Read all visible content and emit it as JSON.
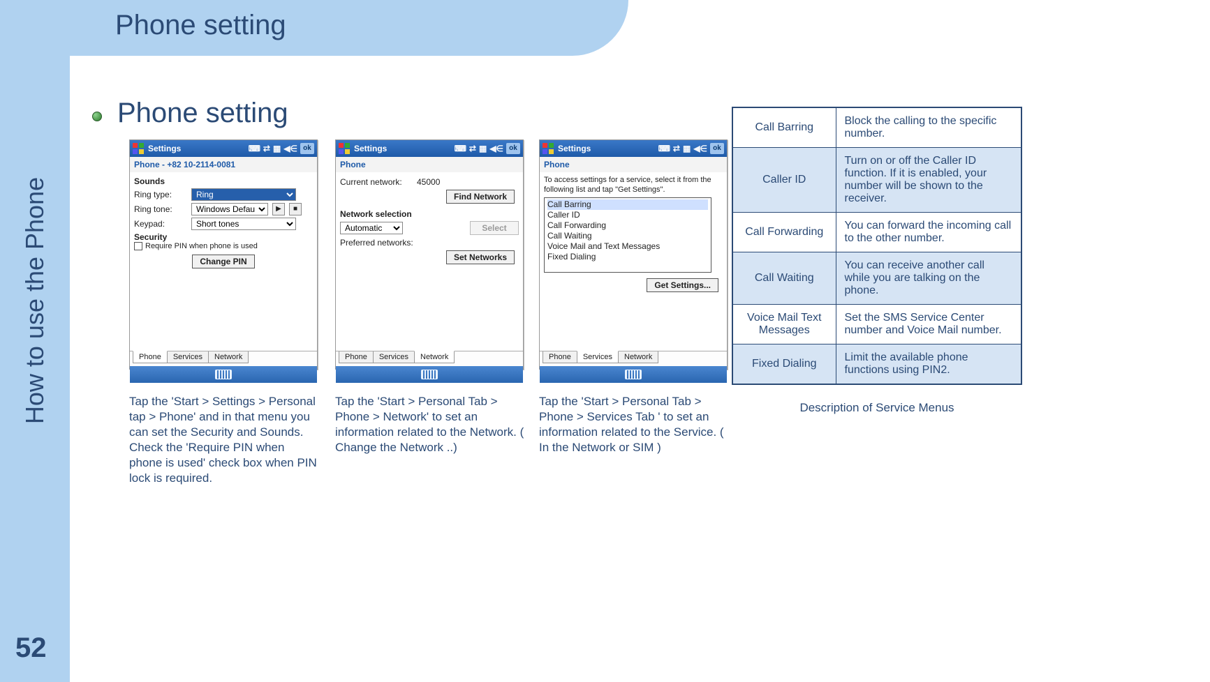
{
  "page": {
    "title": "Phone setting",
    "section_heading": "Phone setting",
    "side_label": "How to use the Phone",
    "number": "52"
  },
  "pda_common": {
    "window_title": "Settings",
    "ok": "ok",
    "tabs": {
      "phone": "Phone",
      "services": "Services",
      "network": "Network"
    }
  },
  "pda1": {
    "subheader": "Phone - +82 10-2114-0081",
    "sounds_label": "Sounds",
    "ring_type_label": "Ring type:",
    "ring_type_value": "Ring",
    "ring_tone_label": "Ring tone:",
    "ring_tone_value": "Windows Default",
    "keypad_label": "Keypad:",
    "keypad_value": "Short tones",
    "security_label": "Security",
    "require_pin_label": "Require PIN when phone is used",
    "change_pin": "Change PIN"
  },
  "pda2": {
    "subheader": "Phone",
    "current_network_label": "Current network:",
    "current_network_value": "45000",
    "find_network": "Find Network",
    "netsel_label": "Network selection",
    "netsel_value": "Automatic",
    "select_btn": "Select",
    "pref_label": "Preferred networks:",
    "set_networks": "Set Networks"
  },
  "pda3": {
    "subheader": "Phone",
    "intro": "To access settings for a service, select it from the following list and tap \"Get Settings\".",
    "items": [
      "Call Barring",
      "Caller ID",
      "Call Forwarding",
      "Call Waiting",
      "Voice Mail and Text Messages",
      "Fixed Dialing"
    ],
    "get_settings": "Get Settings..."
  },
  "captions": {
    "c1": "Tap the 'Start > Settings > Personal tap > Phone' and in that menu you can set the Security and Sounds. Check the 'Require PIN when phone is used' check box when PIN lock is required.",
    "c2": "Tap the 'Start > Personal Tab > Phone > Network' to set an information related to the Network. ( Change the Network ..)",
    "c3": "Tap the 'Start > Personal Tab > Phone > Services Tab ' to set an information related to the Service. ( In the Network or SIM )"
  },
  "service_table": {
    "caption": "Description of Service Menus",
    "rows": [
      {
        "name": "Call Barring",
        "desc": "Block the calling to the specific number."
      },
      {
        "name": "Caller ID",
        "desc": "Turn on or off the Caller ID function. If it is enabled, your number will be shown to the receiver."
      },
      {
        "name": "Call Forwarding",
        "desc": "You can forward the incoming call to the other number."
      },
      {
        "name": "Call Waiting",
        "desc": "You can receive another call while you are talking on the phone."
      },
      {
        "name": "Voice Mail  Text Messages",
        "desc": "Set the SMS Service Center number and Voice Mail number."
      },
      {
        "name": "Fixed Dialing",
        "desc": "Limit the available phone functions using PIN2."
      }
    ]
  }
}
